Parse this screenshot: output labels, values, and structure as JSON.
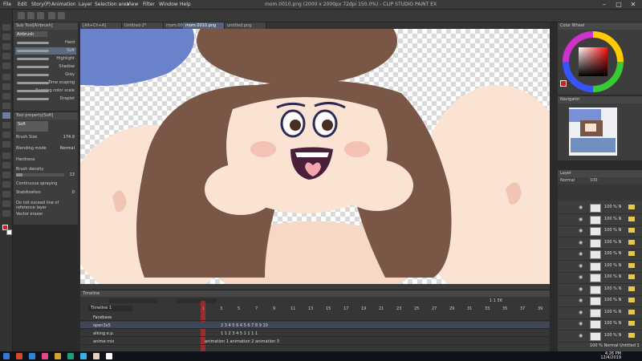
{
  "app": {
    "title": "mom.0010.png (2000 x 2000px 72dpi 150.0%) - CLIP STUDIO PAINT EX",
    "menu": [
      "File",
      "Edit",
      "Story(P)",
      "Animation",
      "Layer",
      "Selection area",
      "View",
      "Filter",
      "Window",
      "Help"
    ],
    "window_buttons": [
      "–",
      "□",
      "✕"
    ]
  },
  "subtool": {
    "header": "Sub Tool[Airbrush]",
    "group": "Airbrush",
    "brushes": [
      "Hard",
      "Soft",
      "Highlight",
      "Shadow",
      "Grey",
      "Time scaping",
      "Running color scale",
      "Droplet"
    ],
    "selected_index": 1
  },
  "tool_property": {
    "header": "Tool property[Soft]",
    "tab": "Soft",
    "brush_size_label": "Brush Size",
    "brush_size_value": "174.9",
    "blending_label": "Blending mode",
    "blending_value": "Normal",
    "hardness_label": "Hardness",
    "density_label": "Brush density",
    "density_value": "13",
    "density_fraction": 0.13,
    "cont_spray_label": "Continuous spraying",
    "stabilization_label": "Stabilization",
    "stabilization_value": "0",
    "no_exceed_label": "Do not exceed line of reference layer",
    "vector_label": "Vector eraser",
    "colors": {
      "main": "#e01818",
      "sub": "#ffffff"
    }
  },
  "canvas_tabs": [
    "[Alt+Ch+A]",
    "Untitled-2*",
    "mom.0009.png...",
    "mom.0010.png",
    "untitled.png"
  ],
  "active_tab_index": 3,
  "timeline": {
    "header": "Timeline",
    "name": "Timeline 1",
    "frame_numbers": [
      "1",
      "3",
      "5",
      "7",
      "9",
      "11",
      "13",
      "15",
      "17",
      "19",
      "21",
      "23",
      "25",
      "27",
      "29",
      "31",
      "33",
      "35",
      "37",
      "39"
    ],
    "rows": [
      {
        "name": "Facebase",
        "cells": ""
      },
      {
        "name": "open3x5",
        "cells": "2  3  4  5  6  4  5  6  7  8       9  10"
      },
      {
        "name": "alking e.p.",
        "cells": "1     1     2  3        4  5  1   1      1  1"
      },
      {
        "name": "anime mix",
        "cells": "animation 1       animation 2       animation 3"
      }
    ],
    "page_info": "1     1     56"
  },
  "color_wheel": {
    "header": "Color Wheel"
  },
  "navigator": {
    "header": "Navigator"
  },
  "layers": {
    "header": "Layer",
    "blend": "Normal",
    "opacity": "100",
    "rows": [
      "100 % N",
      "100 % N",
      "100 % N",
      "100 % N",
      "100 % N",
      "100 % N",
      "100 % N",
      "100 % N",
      "100 % N",
      "100 % N",
      "100 % N",
      "100 % N"
    ],
    "footer": "100 % Normal Untitled 1"
  },
  "taskbar": {
    "time": "4:26 PM",
    "date": "12/4/2019"
  }
}
